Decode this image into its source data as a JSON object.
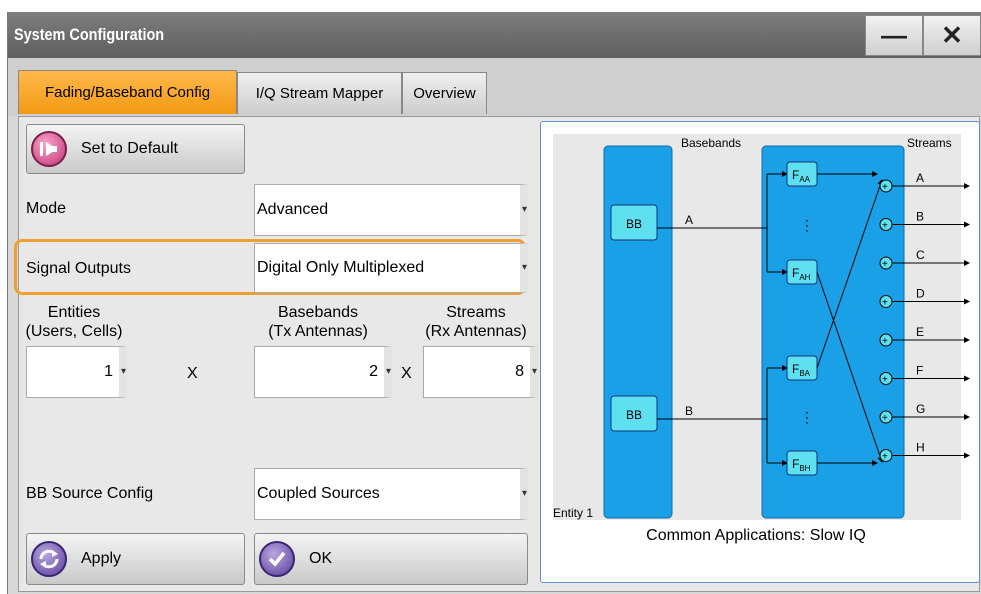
{
  "window": {
    "title": "System Configuration",
    "minimize_glyph": "—",
    "close_glyph": "✕"
  },
  "tabs": [
    {
      "label": "Fading/Baseband Config",
      "active": true
    },
    {
      "label": "I/Q Stream Mapper",
      "active": false
    },
    {
      "label": "Overview",
      "active": false
    }
  ],
  "config": {
    "set_default_label": "Set to Default",
    "mode_label": "Mode",
    "mode_value": "Advanced",
    "signal_outputs_label": "Signal Outputs",
    "signal_outputs_value": "Digital Only Multiplexed",
    "entities_label_1": "Entities",
    "entities_label_2": "(Users, Cells)",
    "entities_value": "1",
    "basebands_label_1": "Basebands",
    "basebands_label_2": "(Tx Antennas)",
    "basebands_value": "2",
    "streams_label_1": "Streams",
    "streams_label_2": "(Rx Antennas)",
    "streams_value": "8",
    "times_sign": "X",
    "bb_source_label": "BB Source Config",
    "bb_source_value": "Coupled Sources",
    "apply_label": "Apply",
    "ok_label": "OK"
  },
  "diagram": {
    "basebands_header": "Basebands",
    "streams_header": "Streams",
    "bb_block_label": "BB",
    "bb_lines": [
      "A",
      "B"
    ],
    "fader_top": [
      {
        "main": "F",
        "sub": "AA"
      },
      {
        "main": "F",
        "sub": "AH"
      }
    ],
    "fader_bottom": [
      {
        "main": "F",
        "sub": "BA"
      },
      {
        "main": "F",
        "sub": "BH"
      }
    ],
    "ellipsis": "⋮",
    "streams": [
      "A",
      "B",
      "C",
      "D",
      "E",
      "F",
      "G",
      "H"
    ],
    "entity_label": "Entity 1",
    "caption": "Common Applications: Slow IQ"
  },
  "colors": {
    "accent": "#f29a14",
    "block_blue": "#1aa0e6",
    "fader_cyan": "#5ee0f0",
    "diagram_border": "#5b8fd0"
  }
}
